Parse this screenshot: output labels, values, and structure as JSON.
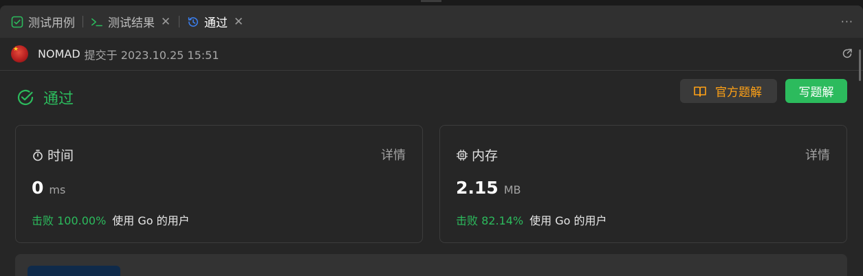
{
  "tabs": [
    {
      "label": "测试用例",
      "icon": "checkbox-icon",
      "closable": false,
      "active": false
    },
    {
      "label": "测试结果",
      "icon": "terminal-icon",
      "closable": true,
      "active": false
    },
    {
      "label": "通过",
      "icon": "history-icon",
      "closable": true,
      "active": true
    }
  ],
  "tabbar": {
    "more_label": "···"
  },
  "submission": {
    "user": "NOMAD",
    "meta": "提交于 2023.10.25 15:51"
  },
  "result": {
    "status": "通过",
    "official_solution_label": "官方题解",
    "write_solution_label": "写题解"
  },
  "runtime": {
    "title": "时间",
    "detail_label": "详情",
    "value": "0",
    "unit": "ms",
    "beat_text": "击败 100.00%",
    "beat_suffix": "使用 Go 的用户"
  },
  "memory": {
    "title": "内存",
    "detail_label": "详情",
    "value": "2.15",
    "unit": "MB",
    "beat_text": "击败 82.14%",
    "beat_suffix": "使用 Go 的用户"
  },
  "colors": {
    "accent_green": "#2cbb5d",
    "accent_orange": "#ffa116",
    "tab_icon_blue": "#3b82f6"
  }
}
